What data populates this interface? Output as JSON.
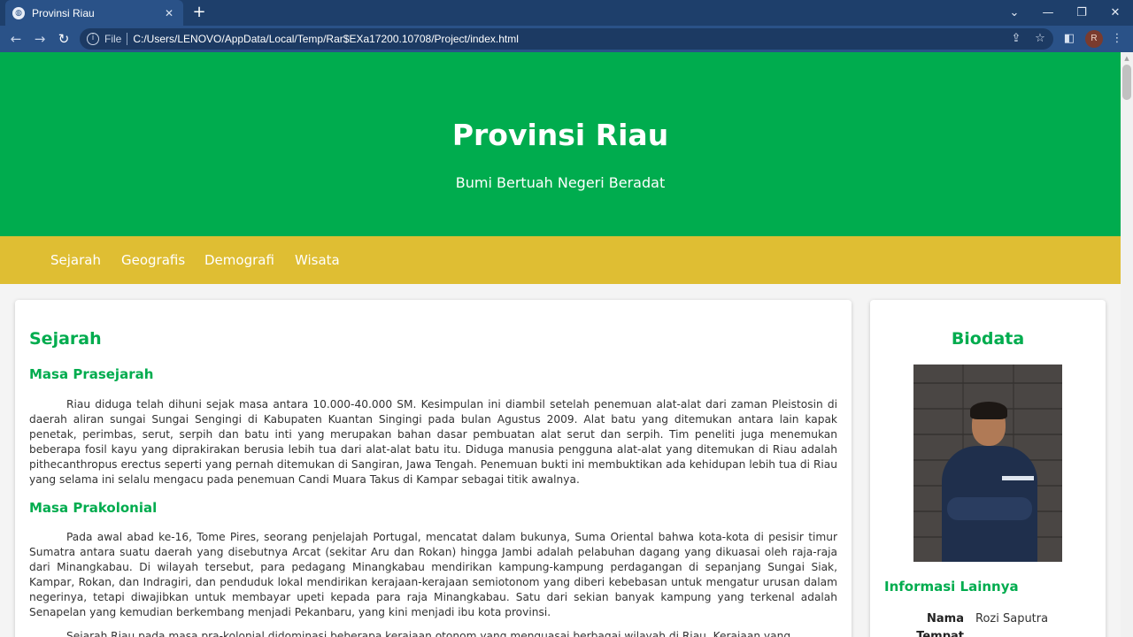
{
  "browser": {
    "tab_title": "Provinsi Riau",
    "file_label": "File",
    "url": "C:/Users/LENOVO/AppData/Local/Temp/Rar$EXa17200.10708/Project/index.html",
    "profile_initial": "R"
  },
  "header": {
    "title": "Provinsi Riau",
    "subtitle": "Bumi Bertuah Negeri Beradat"
  },
  "nav": {
    "items": [
      "Sejarah",
      "Geografis",
      "Demografi",
      "Wisata"
    ]
  },
  "main": {
    "section_title": "Sejarah",
    "sections": [
      {
        "title": "Masa Prasejarah",
        "text": "Riau diduga telah dihuni sejak masa antara 10.000-40.000 SM. Kesimpulan ini diambil setelah penemuan alat-alat dari zaman Pleistosin di daerah aliran sungai Sungai Sengingi di Kabupaten Kuantan Singingi pada bulan Agustus 2009. Alat batu yang ditemukan antara lain kapak penetak, perimbas, serut, serpih dan batu inti yang merupakan bahan dasar pembuatan alat serut dan serpih. Tim peneliti juga menemukan beberapa fosil kayu yang diprakirakan berusia lebih tua dari alat-alat batu itu. Diduga manusia pengguna alat-alat yang ditemukan di Riau adalah pithecanthropus erectus seperti yang pernah ditemukan di Sangiran, Jawa Tengah. Penemuan bukti ini membuktikan ada kehidupan lebih tua di Riau yang selama ini selalu mengacu pada penemuan Candi Muara Takus di Kampar sebagai titik awalnya."
      },
      {
        "title": "Masa Prakolonial",
        "text": "Pada awal abad ke-16, Tome Pires, seorang penjelajah Portugal, mencatat dalam bukunya, Suma Oriental bahwa kota-kota di pesisir timur Sumatra antara suatu daerah yang disebutnya Arcat (sekitar Aru dan Rokan) hingga Jambi adalah pelabuhan dagang yang dikuasai oleh raja-raja dari Minangkabau. Di wilayah tersebut, para pedagang Minangkabau mendirikan kampung-kampung perdagangan di sepanjang Sungai Siak, Kampar, Rokan, dan Indragiri, dan penduduk lokal mendirikan kerajaan-kerajaan semiotonom yang diberi kebebasan untuk mengatur urusan dalam negerinya, tetapi diwajibkan untuk membayar upeti kepada para raja Minangkabau. Satu dari sekian banyak kampung yang terkenal adalah Senapelan yang kemudian berkembang menjadi Pekanbaru, yang kini menjadi ibu kota provinsi.",
        "text_next": "Sejarah Riau pada masa pra-kolonial didominasi beberapa kerajaan otonom yang menguasai berbagai wilayah di Riau. Kerajaan yang"
      }
    ]
  },
  "sidebar": {
    "title": "Biodata",
    "info_title": "Informasi Lainnya",
    "rows": [
      {
        "key": "Nama",
        "value": "Rozi Saputra"
      },
      {
        "key": "Tempat",
        "value": ""
      }
    ]
  }
}
